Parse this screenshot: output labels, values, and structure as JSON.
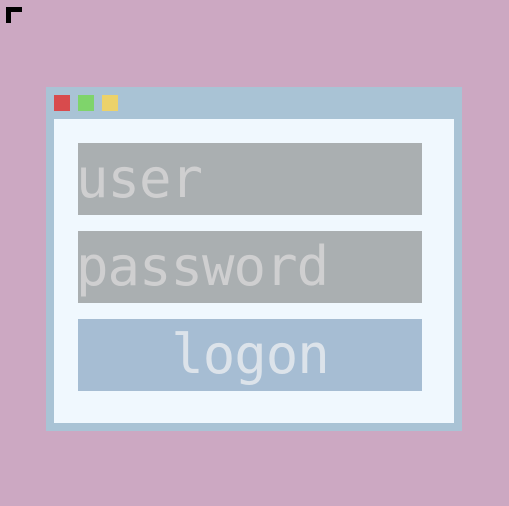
{
  "login_form": {
    "username_placeholder": "user",
    "password_placeholder": "password",
    "logon_label": "logon"
  },
  "window_controls": {
    "close_color": "#d84b4d",
    "maximize_color": "#7fd46b",
    "minimize_color": "#ecd26a"
  },
  "colors": {
    "desktop": "#cca8c2",
    "window_frame": "#a9c3d5",
    "window_body": "#f0f8fe",
    "input_background": "#aaafb1",
    "button_background": "#a6bdd3"
  },
  "icons": {
    "pointer": "mouse-pointer-icon"
  }
}
